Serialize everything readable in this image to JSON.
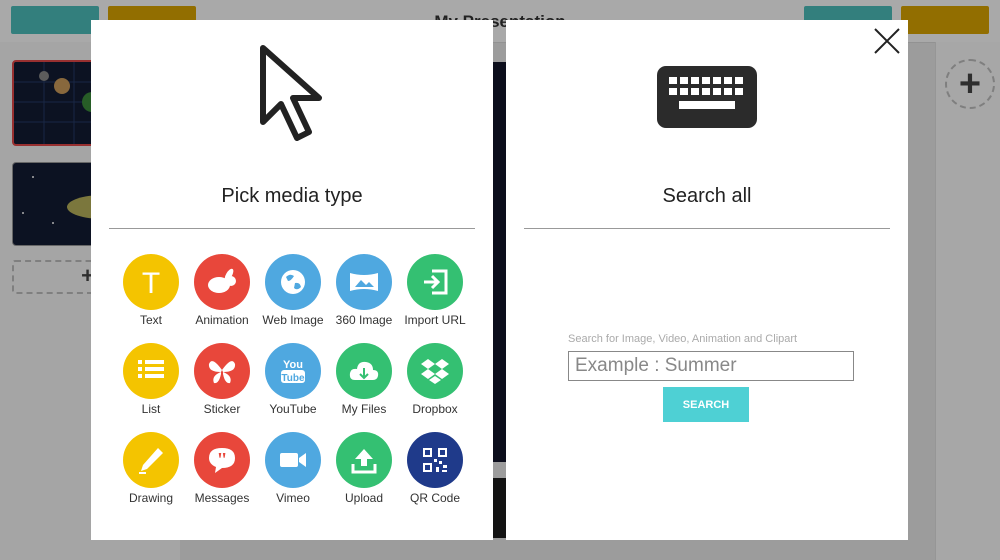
{
  "app": {
    "title": "My Presentation",
    "colors": {
      "teal": "#4cbcb8",
      "gold": "#d8a200",
      "accent_red": "#e04848"
    }
  },
  "media_picker": {
    "icon": "cursor-arrow-icon",
    "title": "Pick media type",
    "items": [
      {
        "label": "Text",
        "icon": "text-t-icon",
        "color": "#f4c400"
      },
      {
        "label": "Animation",
        "icon": "rabbit-icon",
        "color": "#e8473b"
      },
      {
        "label": "Web Image",
        "icon": "globe-icon",
        "color": "#4fa8e0"
      },
      {
        "label": "360 Image",
        "icon": "panorama-icon",
        "color": "#4fa8e0"
      },
      {
        "label": "Import URL",
        "icon": "import-icon",
        "color": "#34c072"
      },
      {
        "label": "List",
        "icon": "list-icon",
        "color": "#f4c400"
      },
      {
        "label": "Sticker",
        "icon": "butterfly-icon",
        "color": "#e8473b"
      },
      {
        "label": "YouTube",
        "icon": "youtube-icon",
        "color": "#4fa8e0"
      },
      {
        "label": "My Files",
        "icon": "cloud-download-icon",
        "color": "#34c072"
      },
      {
        "label": "Dropbox",
        "icon": "dropbox-icon",
        "color": "#34c072"
      },
      {
        "label": "Drawing",
        "icon": "pencil-icon",
        "color": "#f4c400"
      },
      {
        "label": "Messages",
        "icon": "quote-bubble-icon",
        "color": "#e8473b"
      },
      {
        "label": "Vimeo",
        "icon": "video-camera-icon",
        "color": "#4fa8e0"
      },
      {
        "label": "Upload",
        "icon": "upload-icon",
        "color": "#34c072"
      },
      {
        "label": "QR Code",
        "icon": "qr-code-icon",
        "color": "#1f3a8a"
      }
    ]
  },
  "search": {
    "icon": "keyboard-icon",
    "title": "Search all",
    "hint": "Search for Image, Video, Animation and Clipart",
    "placeholder": "Example : Summer",
    "value": "",
    "button_label": "SEARCH",
    "close_icon": "close-icon"
  }
}
